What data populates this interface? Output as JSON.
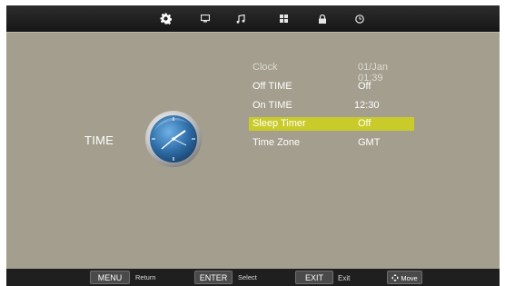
{
  "tabs": [
    {
      "icon": "gear-icon",
      "active": true
    },
    {
      "icon": "monitor-icon",
      "active": false
    },
    {
      "icon": "music-note-icon",
      "active": false
    },
    {
      "icon": "grid-icon",
      "active": false
    },
    {
      "icon": "lock-icon",
      "active": false
    },
    {
      "icon": "clock-icon",
      "active": false
    }
  ],
  "page": {
    "title": "TIME",
    "icon": "analog-clock-icon"
  },
  "menu": {
    "clock": {
      "label": "Clock",
      "value": "01/Jan  01:39"
    },
    "off_time": {
      "label": "Off TIME",
      "value": "Off"
    },
    "on_time": {
      "label": "On TIME",
      "value": "12:30"
    },
    "sleep_timer": {
      "label": "Sleep  Timer",
      "value": "Off"
    },
    "time_zone": {
      "label": "Time Zone",
      "value": "GMT"
    }
  },
  "footer": {
    "menu": {
      "key": "MENU",
      "action": "Return"
    },
    "enter": {
      "key": "ENTER",
      "action": "Select"
    },
    "exit": {
      "key": "EXIT",
      "action": "Exit"
    },
    "move": {
      "key": "Move",
      "icon": "four-arrows-icon"
    }
  },
  "colors": {
    "background": "#a39e8d",
    "highlight": "#c9cb2a",
    "bar": "#1f1f1f",
    "clock_face": "#2f6ea8"
  }
}
